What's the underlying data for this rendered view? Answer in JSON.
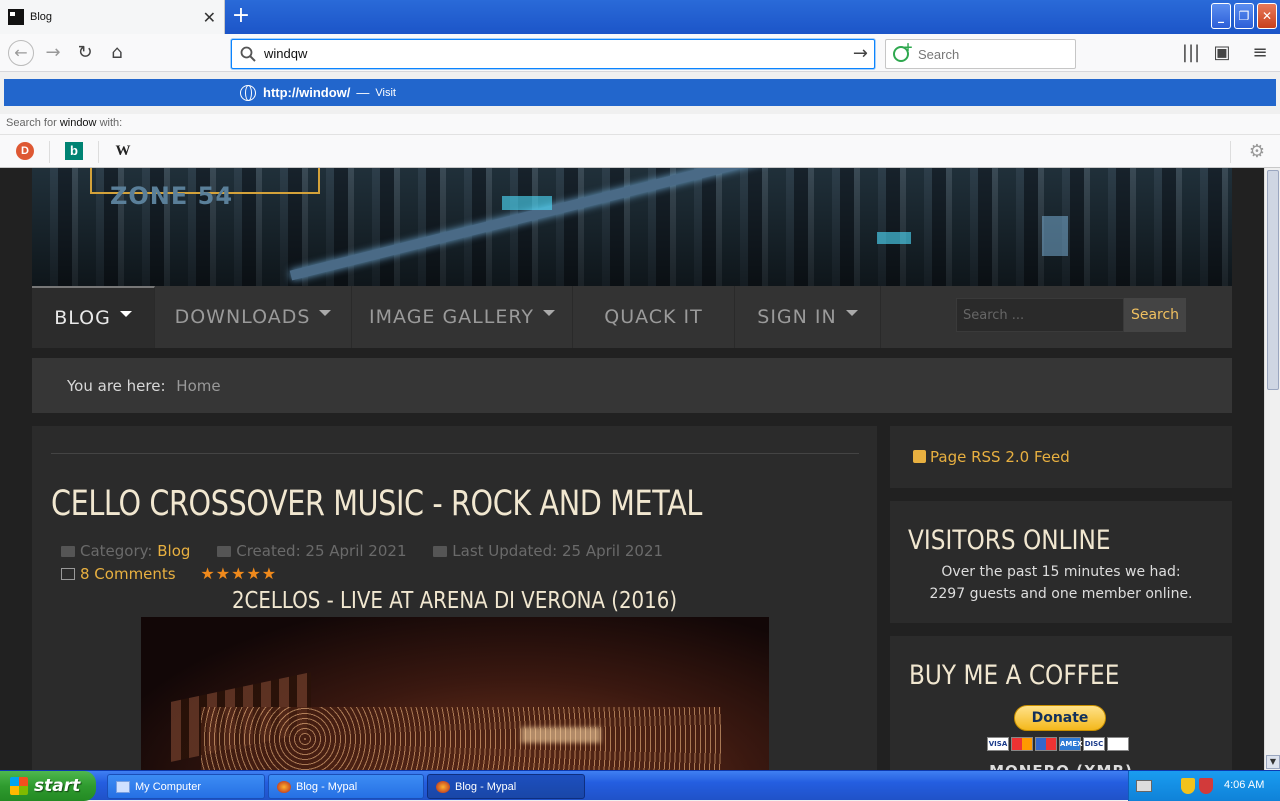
{
  "browser": {
    "tab_title": "Blog",
    "url_value": "windqw",
    "search_placeholder": "Search",
    "suggestion_url": "http://window/",
    "suggestion_sep": "—",
    "suggestion_action": "Visit",
    "search_with_prefix": "Search for",
    "search_with_term": "window",
    "search_with_suffix": "with:",
    "engines": [
      "duckduckgo-icon",
      "bing-icon",
      "wikipedia-icon"
    ]
  },
  "site": {
    "banner_logo": "ZONE 54",
    "nav": [
      {
        "label": "BLOG"
      },
      {
        "label": "DOWNLOADS"
      },
      {
        "label": "IMAGE GALLERY"
      },
      {
        "label": "QUACK IT"
      },
      {
        "label": "SIGN IN"
      }
    ],
    "search_placeholder": "Search ...",
    "search_button": "Search",
    "breadcrumb_label": "You are here:",
    "breadcrumb_home": "Home"
  },
  "article": {
    "title": "CELLO CROSSOVER MUSIC - ROCK AND METAL",
    "category_label": "Category:",
    "category": "Blog",
    "created": "Created: 25 April 2021",
    "updated": "Last Updated: 25 April 2021",
    "comments": "8 Comments",
    "stars": "★★★★★",
    "rating": 5,
    "video_title": "2CELLOS - LIVE AT ARENA DI VERONA (2016)"
  },
  "sidebar": {
    "rss": "Page RSS 2.0 Feed",
    "visitors_title": "VISITORS ONLINE",
    "visitors_line1": "Over the past 15 minutes we had:",
    "visitors_line2": "2297 guests and one member online.",
    "coffee_title": "BUY ME A COFFEE",
    "donate_label": "Donate",
    "cards": [
      "VISA",
      "",
      "",
      "AMEX",
      "DISC",
      ""
    ],
    "monero": "MONERO (XMR)"
  },
  "taskbar": {
    "start": "start",
    "buttons": [
      {
        "label": "My Computer"
      },
      {
        "label": "Blog - Mypal"
      },
      {
        "label": "Blog - Mypal"
      }
    ],
    "clock": "4:06 AM"
  }
}
